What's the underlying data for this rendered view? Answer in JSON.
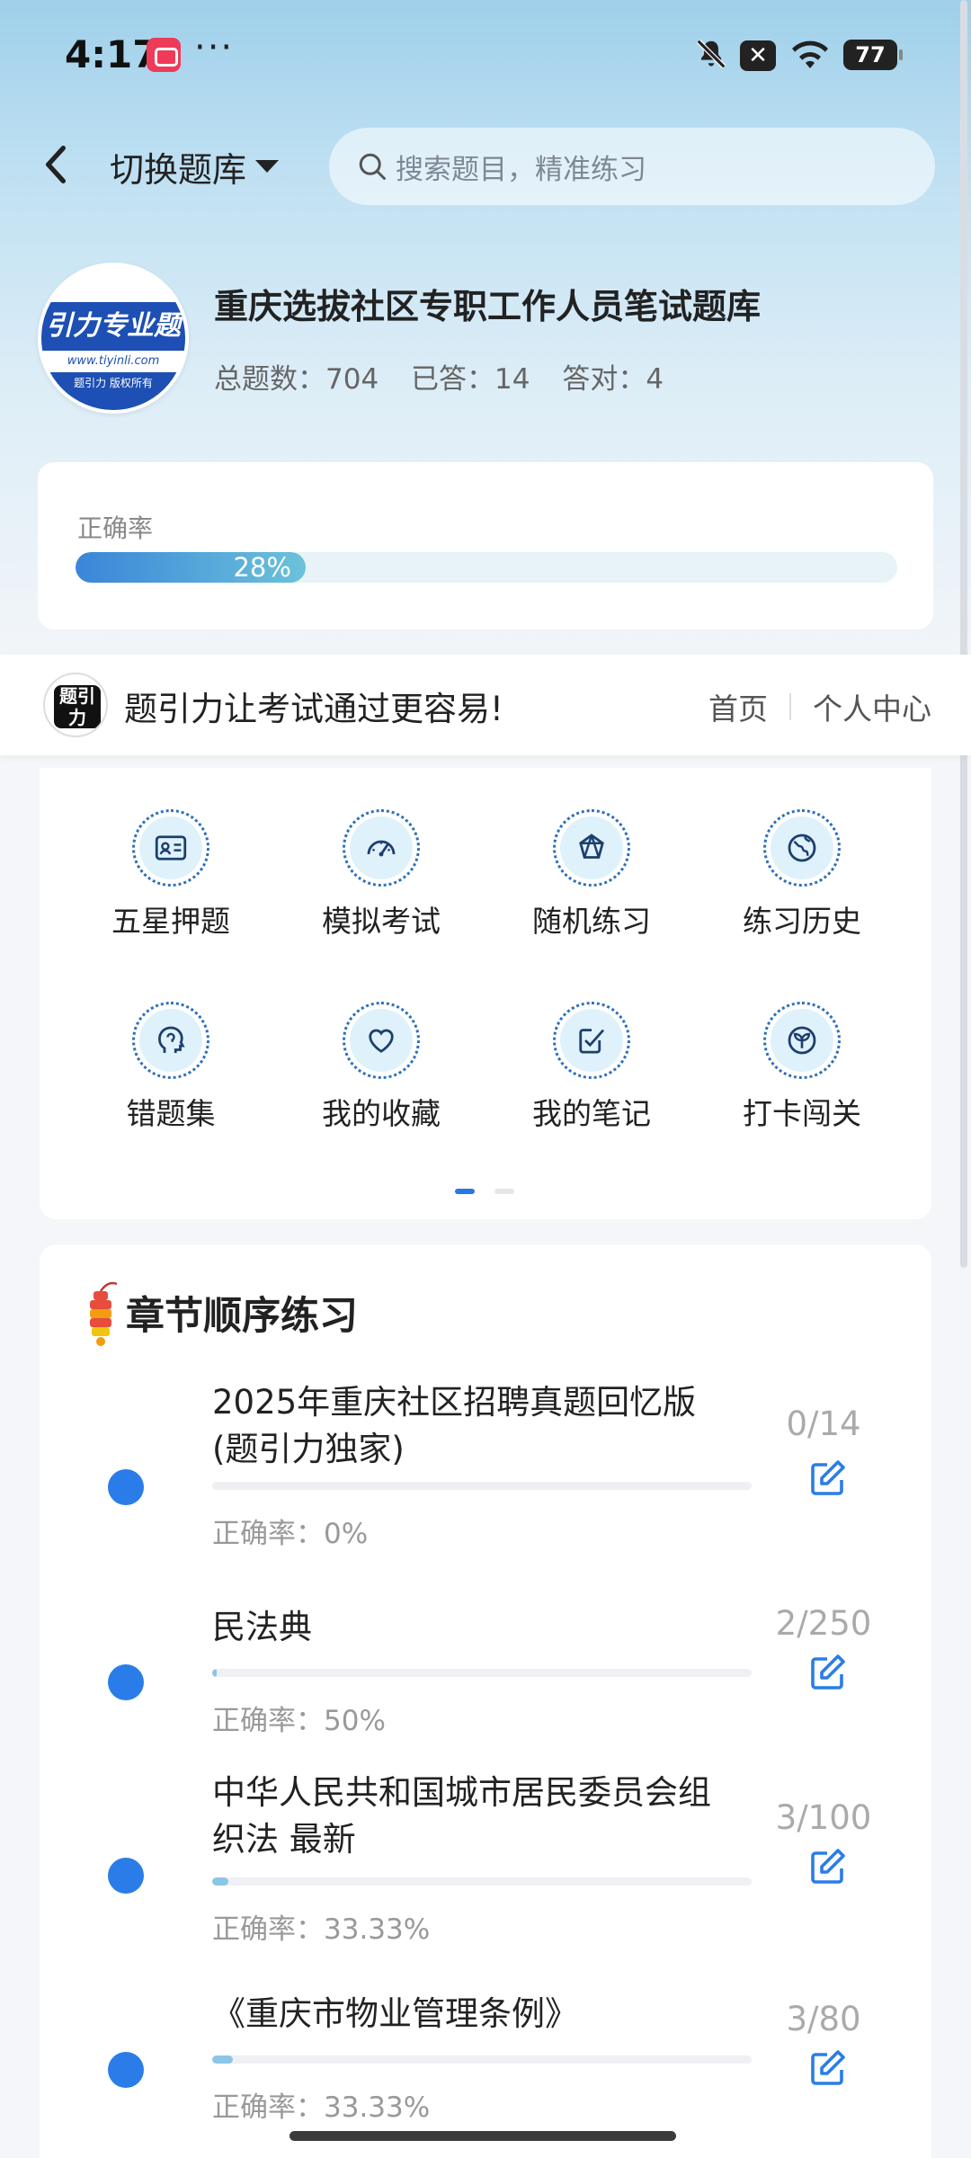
{
  "status_bar": {
    "time": "4:17",
    "more": "···",
    "battery": "77"
  },
  "nav": {
    "switch_label": "切换题库",
    "search_placeholder": "搜索题目，精准练习"
  },
  "bank": {
    "logo_brand": "引力专业题",
    "logo_url": "www.tiyinli.com",
    "logo_footer": "题引力 版权所有",
    "title": "重庆选拔社区专职工作人员笔试题库",
    "total": "总题数：704",
    "answered": "已答：14",
    "correct": "答对：4"
  },
  "accuracy": {
    "label": "正确率",
    "value_text": "28%",
    "value": 0.28
  },
  "brand_strip": {
    "logo_text": "题引力",
    "slogan": "题引力让考试通过更容易!",
    "link_home": "首页",
    "link_profile": "个人中心"
  },
  "menu": {
    "items": [
      {
        "label": "五星押题",
        "icon": "id-card-icon"
      },
      {
        "label": "模拟考试",
        "icon": "speedometer-icon"
      },
      {
        "label": "随机练习",
        "icon": "network-icon"
      },
      {
        "label": "练习历史",
        "icon": "globe-icon"
      },
      {
        "label": "错题集",
        "icon": "head-icon"
      },
      {
        "label": "我的收藏",
        "icon": "heart-icon"
      },
      {
        "label": "我的笔记",
        "icon": "note-check-icon"
      },
      {
        "label": "打卡闯关",
        "icon": "sprout-icon"
      }
    ],
    "page": 1,
    "pages": 2
  },
  "chapters": {
    "title": "章节顺序练习",
    "rows": [
      {
        "line1": "2025年重庆社区招聘真题回忆版",
        "line2": "(题引力独家)",
        "accuracy": "正确率：0%",
        "count": "0/14",
        "progress": 0
      },
      {
        "line1": "民法典",
        "line2": "",
        "accuracy": "正确率：50%",
        "count": "2/250",
        "progress": 0.008
      },
      {
        "line1": "中华人民共和国城市居民委员会组",
        "line2": "织法 最新",
        "accuracy": "正确率：33.33%",
        "count": "3/100",
        "progress": 0.03
      },
      {
        "line1": "《重庆市物业管理条例》",
        "line2": "",
        "accuracy": "正确率：33.33%",
        "count": "3/80",
        "progress": 0.0375
      }
    ]
  },
  "colors": {
    "accent": "#2a7de8",
    "hero_top": "#9fd0ea",
    "logo_blue": "#1d4fb4"
  }
}
